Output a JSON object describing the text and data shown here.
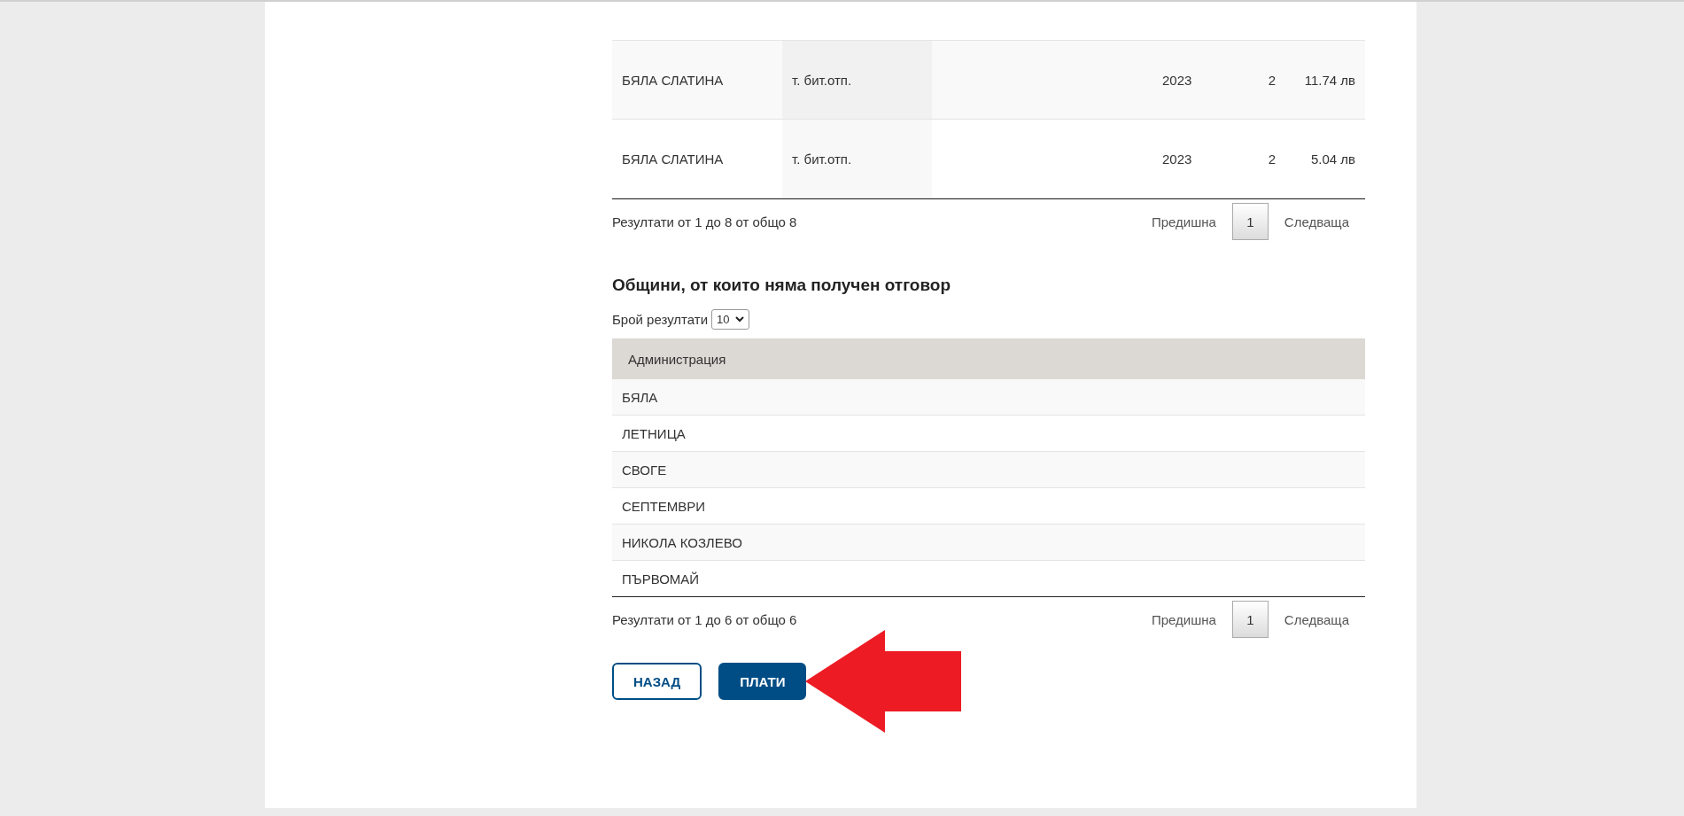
{
  "results_table": {
    "rows": [
      {
        "administration": "БЯЛА СЛАТИНА",
        "type": "т. бит.отп.",
        "year": "2023",
        "column_5": "2",
        "amount": "11.74 лв"
      },
      {
        "administration": "БЯЛА СЛАТИНА",
        "type": "т. бит.отп.",
        "year": "2023",
        "column_5": "2",
        "amount": "5.04 лв"
      }
    ],
    "summary": "Резултати от 1 до 8 от общо 8",
    "pagination": {
      "previous": "Предишна",
      "pages": [
        {
          "label": "1",
          "selected": true
        }
      ],
      "next": "Следваща"
    }
  },
  "no_response_section": {
    "title": "Общини, от които няма получен отговор",
    "page_size": {
      "label": "Брой резултати",
      "value": "10"
    },
    "columns": [
      "Администрация"
    ],
    "rows": [
      "БЯЛА",
      "ЛЕТНИЦА",
      "СВОГЕ",
      "СЕПТЕМВРИ",
      "НИКОЛА КОЗЛЕВО",
      "ПЪРВОМАЙ"
    ],
    "summary": "Резултати от 1 до 6 от общо 6",
    "pagination": {
      "previous": "Предишна",
      "pages": [
        {
          "label": "1",
          "selected": true
        }
      ],
      "next": "Следваща"
    }
  },
  "buttons": [
    {
      "label": "НАЗАД",
      "kind": "outline"
    },
    {
      "label": "ПЛАТИ",
      "kind": "primary"
    }
  ]
}
